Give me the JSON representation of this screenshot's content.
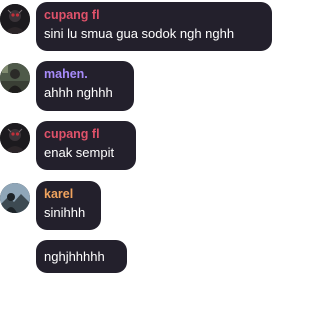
{
  "messages": [
    {
      "name": "cupang fl",
      "name_color": "#e0526a",
      "text": "sini lu smua gua sodok ngh nghh",
      "avatar": "dark-figure-avatar"
    },
    {
      "name": "mahen.",
      "name_color": "#a78bfa",
      "text": "ahhh nghhh",
      "avatar": "outdoor-person-avatar"
    },
    {
      "name": "cupang fl",
      "name_color": "#e0526a",
      "text": "enak sempit",
      "avatar": "dark-figure-avatar"
    },
    {
      "name": "karel",
      "name_color": "#f0a35e",
      "text": "sinihhh",
      "avatar": "landscape-avatar"
    },
    {
      "text": "nghjhhhhh"
    }
  ]
}
